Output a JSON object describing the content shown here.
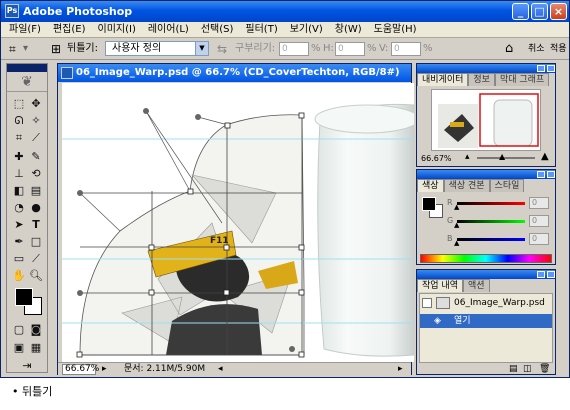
{
  "app": {
    "title": "Adobe Photoshop",
    "logo_text": "Ps"
  },
  "window_controls": {
    "minimize": "_",
    "maximize": "□",
    "close": "×"
  },
  "menu": [
    "파일(F)",
    "편집(E)",
    "이미지(I)",
    "레이어(L)",
    "선택(S)",
    "필터(T)",
    "보기(V)",
    "창(W)",
    "도움말(H)"
  ],
  "options_bar": {
    "warp_label": "뒤틀기:",
    "warp_value": "사용자 정의",
    "bend_label": "구부리기:",
    "bend_value": "0",
    "h_label": "H:",
    "h_value": "0",
    "v_label": "V:",
    "v_value": "0",
    "percent": "%",
    "cancel": "취소",
    "apply": "적용"
  },
  "document": {
    "title": "06_Image_Warp.psd @ 66.7% (CD_CoverTechton, RGB/8#)",
    "zoom": "66.67%",
    "doc_info": "문서: 2.11M/5.90M",
    "tag_text": "F11"
  },
  "navigator_panel": {
    "tabs": [
      "내비게이터",
      "정보",
      "막대 그래프"
    ],
    "zoom": "66.67%"
  },
  "color_panel": {
    "tabs": [
      "색상",
      "색상 견본",
      "스타일"
    ],
    "channels": [
      {
        "label": "R",
        "value": "0",
        "color": "#d01818"
      },
      {
        "label": "G",
        "value": "0",
        "color": "#18a818"
      },
      {
        "label": "B",
        "value": "0",
        "color": "#1818d0"
      }
    ]
  },
  "history_panel": {
    "tabs": [
      "작업 내역",
      "액션"
    ],
    "snapshot": "06_Image_Warp.psd",
    "items": [
      "열기"
    ]
  },
  "caption": "• 뒤틀기"
}
